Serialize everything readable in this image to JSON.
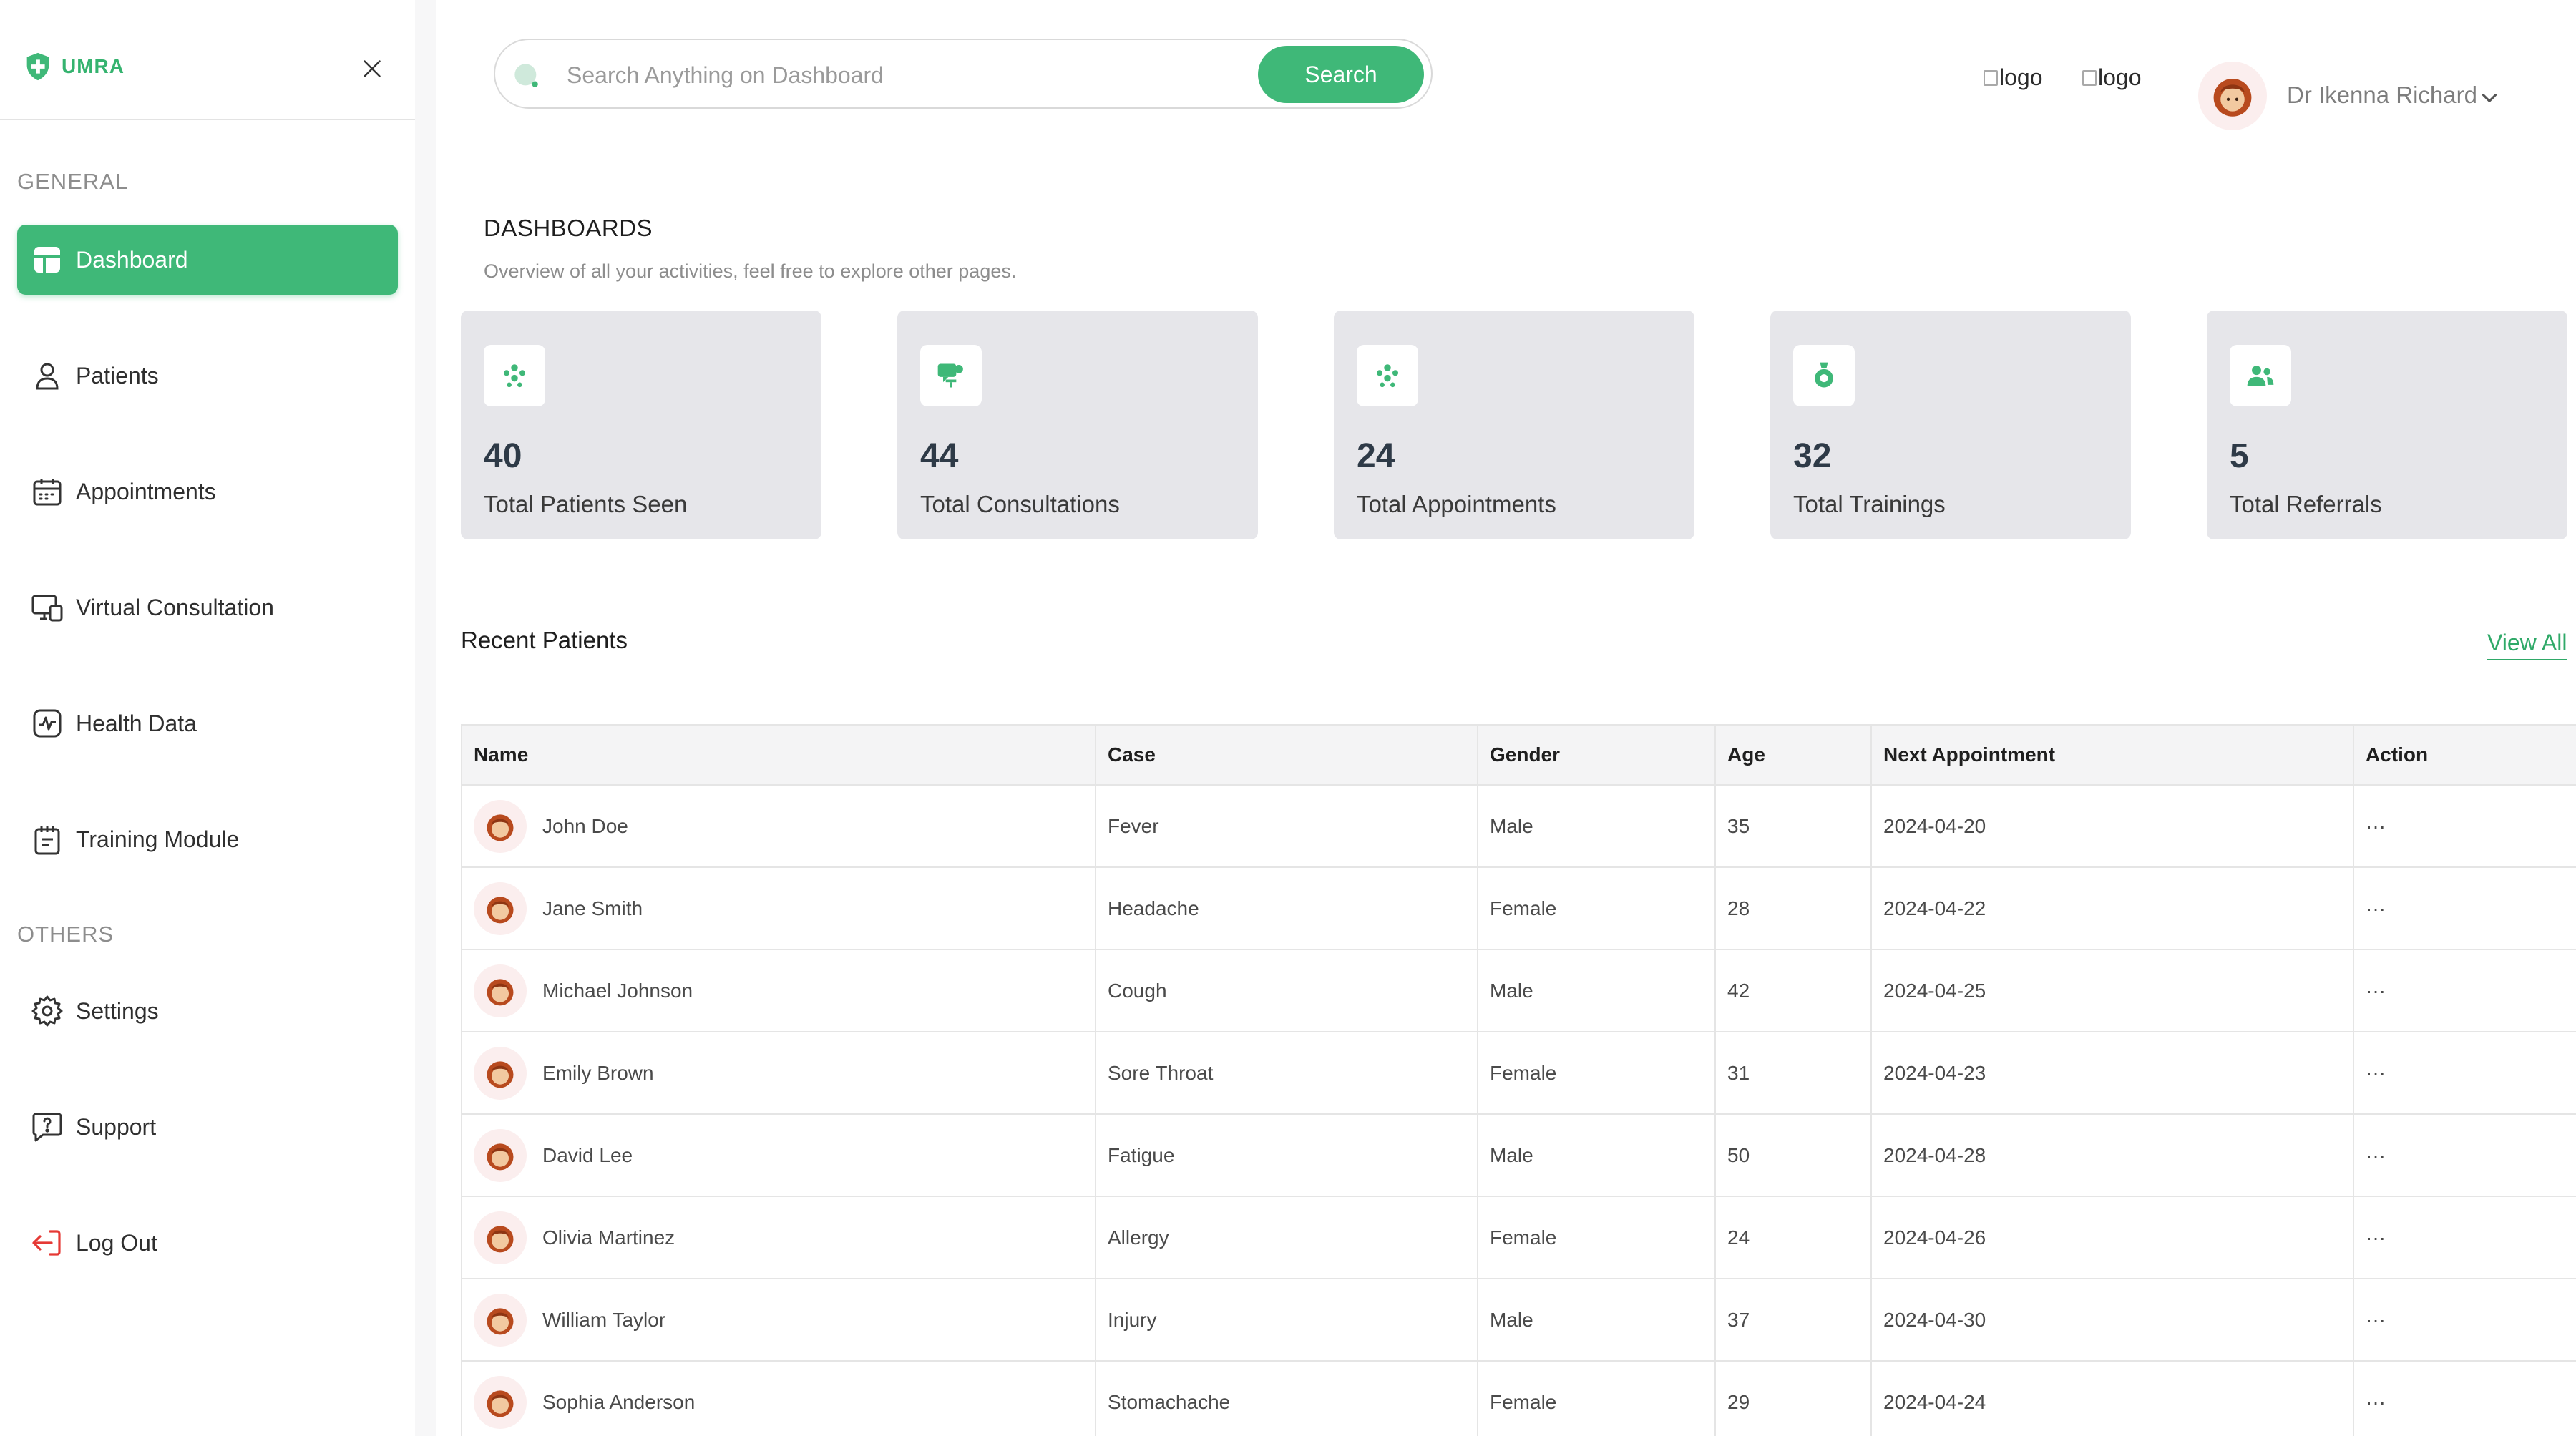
{
  "brand": {
    "name": "UMRA"
  },
  "sidebar": {
    "general_label": "GENERAL",
    "others_label": "OTHERS",
    "general_items": [
      {
        "label": "Dashboard",
        "icon": "dashboard-icon",
        "active": true
      },
      {
        "label": "Patients",
        "icon": "user-icon"
      },
      {
        "label": "Appointments",
        "icon": "calendar-icon"
      },
      {
        "label": "Virtual Consultation",
        "icon": "monitor-icon"
      },
      {
        "label": "Health Data",
        "icon": "pulse-icon"
      },
      {
        "label": "Training Module",
        "icon": "notepad-icon"
      }
    ],
    "other_items": [
      {
        "label": "Settings",
        "icon": "gear-icon"
      },
      {
        "label": "Support",
        "icon": "help-chat-icon"
      },
      {
        "label": "Log Out",
        "icon": "logout-icon"
      }
    ]
  },
  "search": {
    "placeholder": "Search Anything on Dashboard",
    "value": "",
    "button_label": "Search"
  },
  "header": {
    "logo_alt_1": "logo",
    "logo_alt_2": "logo",
    "user_name": "Dr Ikenna Richard"
  },
  "dashboard": {
    "title": "DASHBOARDS",
    "subtitle": "Overview of all your activities, feel free to explore other pages."
  },
  "stats": [
    {
      "value": "40",
      "label": "Total Patients Seen",
      "icon": "group-icon"
    },
    {
      "value": "44",
      "label": "Total Consultations",
      "icon": "consultation-icon"
    },
    {
      "value": "24",
      "label": "Total Appointments",
      "icon": "group-icon"
    },
    {
      "value": "32",
      "label": "Total Trainings",
      "icon": "training-icon"
    },
    {
      "value": "5",
      "label": "Total Referrals",
      "icon": "referral-icon"
    }
  ],
  "recent": {
    "title": "Recent Patients",
    "view_all": "View All",
    "columns": [
      "Name",
      "Case",
      "Gender",
      "Age",
      "Next Appointment",
      "Action"
    ],
    "rows": [
      {
        "name": "John Doe",
        "case": "Fever",
        "gender": "Male",
        "age": "35",
        "next": "2024-04-20",
        "action": "···"
      },
      {
        "name": "Jane Smith",
        "case": "Headache",
        "gender": "Female",
        "age": "28",
        "next": "2024-04-22",
        "action": "···"
      },
      {
        "name": "Michael Johnson",
        "case": "Cough",
        "gender": "Male",
        "age": "42",
        "next": "2024-04-25",
        "action": "···"
      },
      {
        "name": "Emily Brown",
        "case": "Sore Throat",
        "gender": "Female",
        "age": "31",
        "next": "2024-04-23",
        "action": "···"
      },
      {
        "name": "David Lee",
        "case": "Fatigue",
        "gender": "Male",
        "age": "50",
        "next": "2024-04-28",
        "action": "···"
      },
      {
        "name": "Olivia Martinez",
        "case": "Allergy",
        "gender": "Female",
        "age": "24",
        "next": "2024-04-26",
        "action": "···"
      },
      {
        "name": "William Taylor",
        "case": "Injury",
        "gender": "Male",
        "age": "37",
        "next": "2024-04-30",
        "action": "···"
      },
      {
        "name": "Sophia Anderson",
        "case": "Stomachache",
        "gender": "Female",
        "age": "29",
        "next": "2024-04-24",
        "action": "···"
      }
    ]
  },
  "colors": {
    "accent": "#3fb878",
    "card_bg": "#e6e6ea",
    "link": "#2fa968"
  }
}
